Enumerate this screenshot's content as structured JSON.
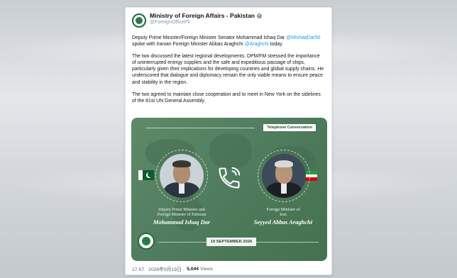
{
  "account": {
    "name": "Ministry of Foreign Affairs - Pakistan",
    "handle": "@ForeignOfficePk"
  },
  "post": {
    "p1_a": "Deputy Prime Minister/Foreign Minister Senator Mohammad Ishaq Dar",
    "p1_mention": "@MIshaqDar50",
    "p1_b": "spoke with Iranian Foreign Minister Abbas Araghchi",
    "p1_mention2": "@Araghchi",
    "p1_c": "today.",
    "p2": "The two discussed the latest regional developments. DPM/FM stressed the importance of uninterrupted energy supplies and the safe and expeditious passage of ships, particularly given their implications for developing countries and global supply chains. He underscored that dialogue and diplomacy remain the only viable means to ensure peace and stability in the region.",
    "p3": "The two agreed to maintain close cooperation and to meet in New York on the sidelines of the 81st UN General Assembly."
  },
  "card": {
    "tag": "Telephone Conversation",
    "left_role_1": "Deputy Prime Minister and",
    "left_role_2": "Foreign Minister of Pakistan",
    "left_name": "Mohammad Ishaq Dar",
    "right_role_1": "Foreign Minister of",
    "right_role_2": "Iran",
    "right_name": "Seyyed Abbas Araghchi",
    "date": "19 SEPTEMBER 2026"
  },
  "footer": {
    "timestamp": "17:57 · 2026年9月19日 ·",
    "views_count": "5,044",
    "views_label": "Views"
  },
  "colors": {
    "card_green": "#4e7c5c",
    "mention_blue": "#1d9bf0"
  }
}
